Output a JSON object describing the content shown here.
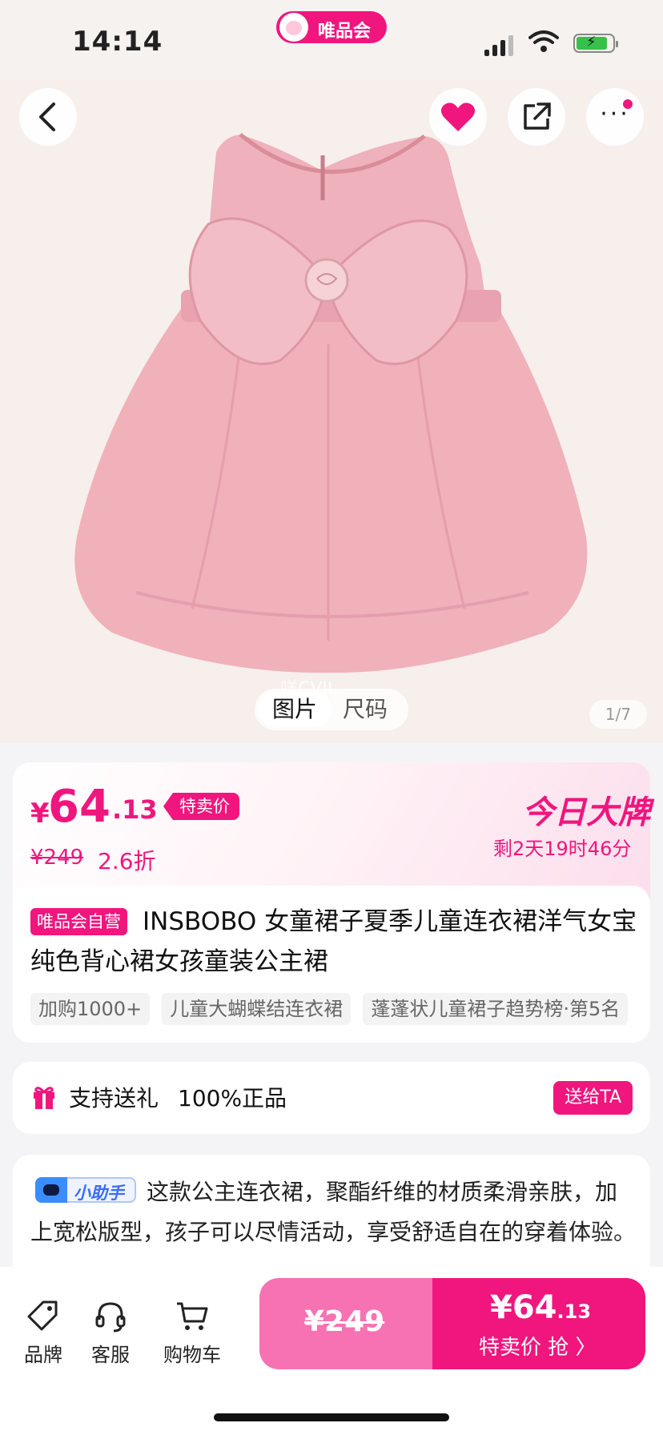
{
  "status": {
    "time": "14:14",
    "app_badge": "唯品会"
  },
  "media": {
    "tabs": [
      "图片",
      "尺码"
    ],
    "counter": "1/7",
    "watermark": "咩CVIL"
  },
  "price": {
    "currency": "¥",
    "integer": "64",
    "decimal": ".13",
    "sale_tag": "特卖价",
    "original": "¥249",
    "discount": "2.6折",
    "brand_day": "今日大牌",
    "countdown": "剩2天19时46分"
  },
  "product": {
    "self_tag": "唯品会自营",
    "title": "INSBOBO 女童裙子夏季儿童连衣裙洋气女宝纯色背心裙女孩童装公主裙",
    "chips": [
      "加购1000+",
      "儿童大蝴蝶结连衣裙",
      "蓬蓬状儿童裙子趋势榜·第5名"
    ]
  },
  "gift": {
    "text": "支持送礼",
    "authentic": "100%正品",
    "button": "送给TA"
  },
  "assistant": {
    "tag": "小助手",
    "text": "这款公主连衣裙，聚酯纤维的材质柔滑亲肤，加上宽松版型，孩子可以尽情活动，享受舒适自在的穿着体验。"
  },
  "bottom": {
    "nav": [
      "品牌",
      "客服",
      "购物车"
    ],
    "buy_original": "¥249",
    "buy_price_int": "¥64",
    "buy_price_dec": ".13",
    "buy_label": "特卖价 抢 〉"
  },
  "colors": {
    "accent": "#f0167e",
    "accent_light": "#f772b3",
    "dress": "#f0b3bd"
  }
}
